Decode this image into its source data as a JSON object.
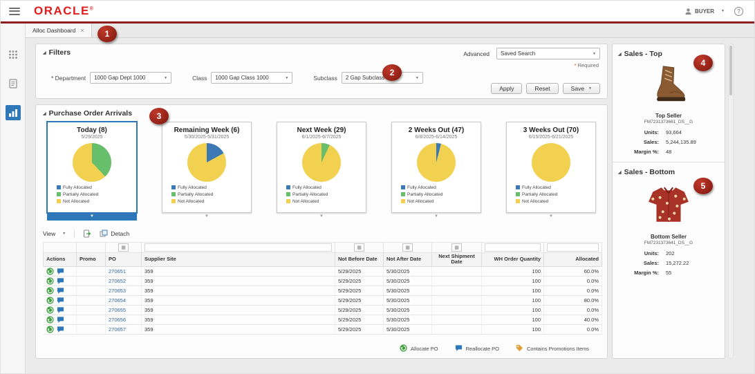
{
  "icons": {
    "close": "×",
    "caret": "▼",
    "help": "?",
    "section": "◢",
    "qbe": "▦",
    "required_star": "*"
  },
  "header": {
    "brand": "ORACLE",
    "registered": "®",
    "user": "BUYER"
  },
  "tab": {
    "label": "Alloc Dashboard"
  },
  "filters": {
    "title": "Filters",
    "advanced": "Advanced",
    "saved_search": "Saved Search",
    "required": "Required",
    "fields": [
      {
        "label": "* Department",
        "value": "1000 Gap Dept 1000"
      },
      {
        "label": "Class",
        "value": "1000 Gap Class 1000"
      },
      {
        "label": "Subclass",
        "value": "2 Gap Subclass 2"
      }
    ],
    "apply": "Apply",
    "reset": "Reset",
    "save": "Save"
  },
  "po_arrivals": {
    "title": "Purchase Order Arrivals",
    "legend": [
      "Fully Allocated",
      "Partially Allocated",
      "Not Allocated"
    ],
    "legend_colors": {
      "fully": "#3d7ab5",
      "partially": "#67bf6b",
      "not": "#f2d150"
    },
    "cards": [
      {
        "title": "Today (8)",
        "dates": "5/29/2025",
        "pie": {
          "fully": 0,
          "partially": 38,
          "not": 62
        },
        "selected": true
      },
      {
        "title": "Remaining Week (6)",
        "dates": "5/30/2025-5/31/2025",
        "pie": {
          "fully": 17,
          "partially": 0,
          "not": 83
        },
        "selected": false
      },
      {
        "title": "Next Week (29)",
        "dates": "6/1/2025-6/7/2025",
        "pie": {
          "fully": 0,
          "partially": 7,
          "not": 93
        },
        "selected": false
      },
      {
        "title": "2 Weeks Out (47)",
        "dates": "6/8/2025-6/14/2025",
        "pie": {
          "fully": 4,
          "partially": 0,
          "not": 96
        },
        "selected": false
      },
      {
        "title": "3 Weeks Out (70)",
        "dates": "6/15/2025-6/21/2025",
        "pie": {
          "fully": 0,
          "partially": 0,
          "not": 100
        },
        "selected": false
      }
    ]
  },
  "table": {
    "toolbar": {
      "view": "View",
      "detach": "Detach"
    },
    "columns": [
      "Actions",
      "Promo",
      "PO",
      "Supplier Site",
      "Not Before Date",
      "Not After Date",
      "Next Shipment Date",
      "WH Order Quantity",
      "Allocated"
    ],
    "rows": [
      {
        "po": "270651",
        "promo": "",
        "supplier_site": "359",
        "not_before": "5/29/2025",
        "not_after": "5/30/2025",
        "next_shipment": "",
        "wh_qty": "100",
        "allocated": "60.0%"
      },
      {
        "po": "270652",
        "promo": "",
        "supplier_site": "359",
        "not_before": "5/29/2025",
        "not_after": "5/30/2025",
        "next_shipment": "",
        "wh_qty": "100",
        "allocated": "0.0%"
      },
      {
        "po": "270653",
        "promo": "",
        "supplier_site": "359",
        "not_before": "5/29/2025",
        "not_after": "5/30/2025",
        "next_shipment": "",
        "wh_qty": "100",
        "allocated": "0.0%"
      },
      {
        "po": "270654",
        "promo": "",
        "supplier_site": "359",
        "not_before": "5/29/2025",
        "not_after": "5/30/2025",
        "next_shipment": "",
        "wh_qty": "100",
        "allocated": "80.0%"
      },
      {
        "po": "270655",
        "promo": "",
        "supplier_site": "359",
        "not_before": "5/29/2025",
        "not_after": "5/30/2025",
        "next_shipment": "",
        "wh_qty": "100",
        "allocated": "0.0%"
      },
      {
        "po": "270656",
        "promo": "",
        "supplier_site": "359",
        "not_before": "5/29/2025",
        "not_after": "5/30/2025",
        "next_shipment": "",
        "wh_qty": "100",
        "allocated": "40.0%"
      },
      {
        "po": "270657",
        "promo": "",
        "supplier_site": "359",
        "not_before": "5/29/2025",
        "not_after": "5/30/2025",
        "next_shipment": "",
        "wh_qty": "100",
        "allocated": "0.0%"
      }
    ],
    "legend": [
      {
        "name": "allocate",
        "label": "Allocate PO"
      },
      {
        "name": "reallocate",
        "label": "Reallocate PO"
      },
      {
        "name": "promotions",
        "label": "Contains Promotions Items"
      }
    ]
  },
  "sales_top": {
    "title": "Sales - Top",
    "seller_label": "Top Seller",
    "item_code": "FM7231373661_DS__G",
    "stats": [
      {
        "label": "Units:",
        "value": "93,664"
      },
      {
        "label": "Sales:",
        "value": "5,244,135.89"
      },
      {
        "label": "Margin %:",
        "value": "48"
      }
    ]
  },
  "sales_bottom": {
    "title": "Sales - Bottom",
    "seller_label": "Bottom Seller",
    "item_code": "FM7231373641_DS__G",
    "stats": [
      {
        "label": "Units:",
        "value": "202"
      },
      {
        "label": "Sales:",
        "value": "15,272.22"
      },
      {
        "label": "Margin %:",
        "value": "55"
      }
    ]
  },
  "annotations": [
    "1",
    "2",
    "3",
    "4",
    "5"
  ]
}
